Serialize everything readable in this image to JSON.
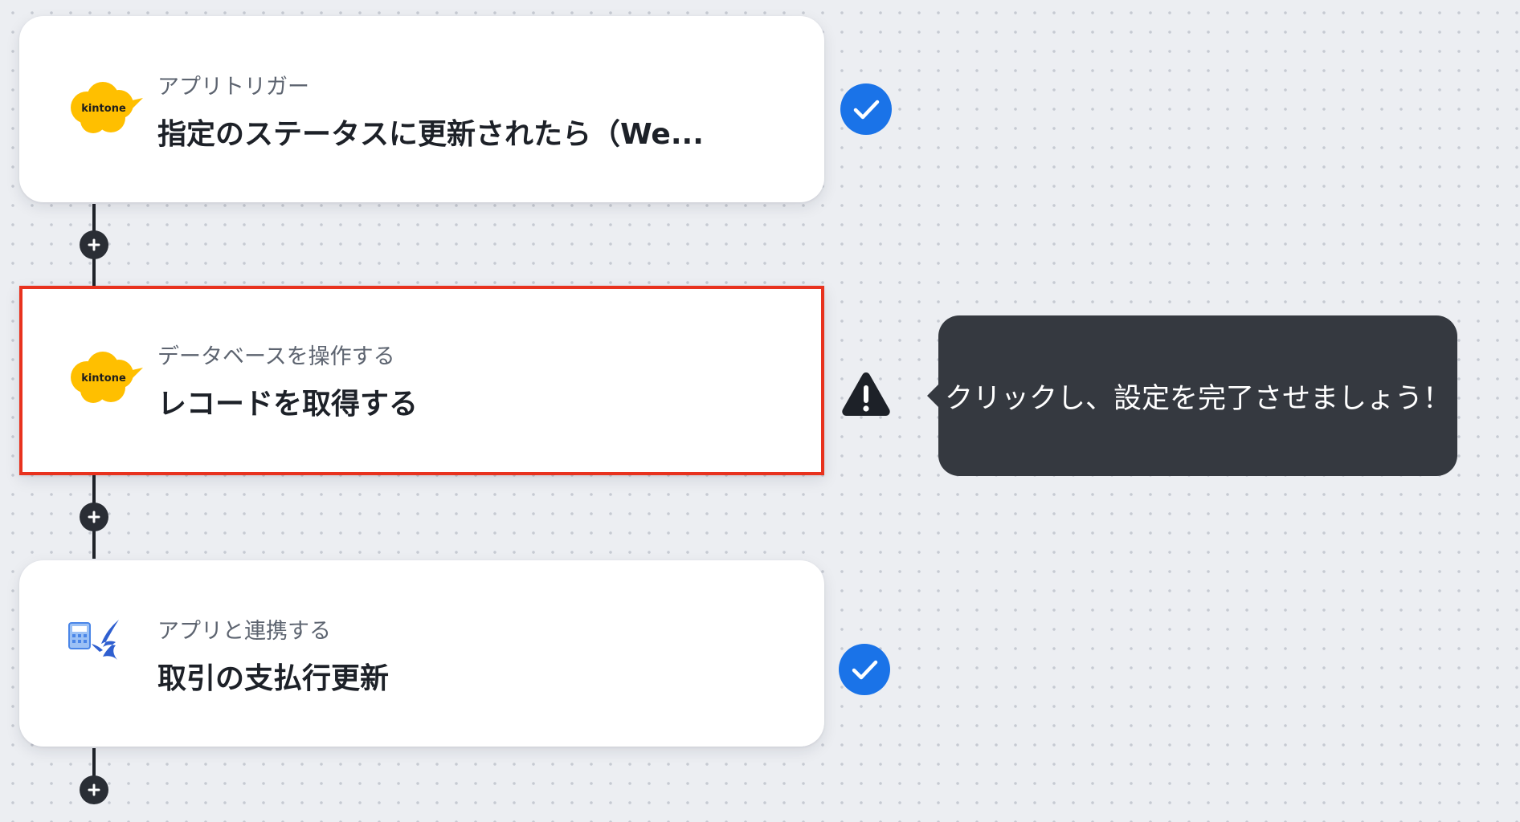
{
  "flow": {
    "steps": [
      {
        "subtitle": "アプリトリガー",
        "title": "指定のステータスに更新されたら（We...",
        "app_icon": "kintone-logo",
        "app_label": "kintone",
        "status": "complete",
        "status_icon": "check-circle-icon"
      },
      {
        "subtitle": "データベースを操作する",
        "title": "レコードを取得する",
        "app_icon": "kintone-logo",
        "app_label": "kintone",
        "status": "warning",
        "status_icon": "warning-triangle-icon",
        "selected": true
      },
      {
        "subtitle": "アプリと連携する",
        "title": "取引の支払行更新",
        "app_icon": "freee-accounting-logo",
        "status": "complete",
        "status_icon": "check-circle-icon"
      }
    ],
    "add_step_icon": "plus-icon"
  },
  "tooltip": {
    "text": "クリックし、設定を完了させましょう！"
  },
  "colors": {
    "check": "#1a73e8",
    "selected_border": "#e8321e",
    "tooltip_bg": "#353940",
    "kintone_yellow": "#ffbf00",
    "connector": "#1f2329"
  }
}
